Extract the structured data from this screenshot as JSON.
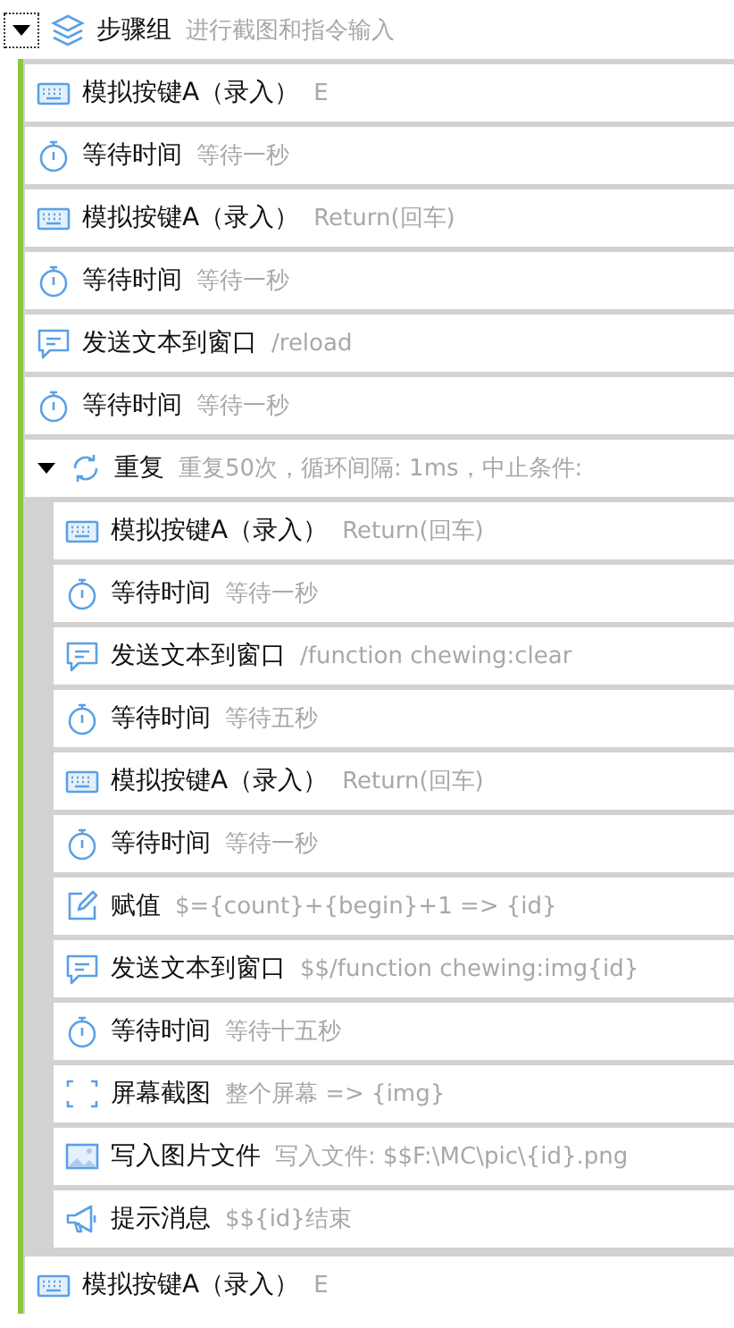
{
  "group": {
    "title": "步骤组",
    "detail": "进行截图和指令输入",
    "expanded": true,
    "steps": [
      {
        "kind": "keyboard",
        "title": "模拟按键A（录入）",
        "detail": "E"
      },
      {
        "kind": "wait",
        "title": "等待时间",
        "detail": "等待一秒"
      },
      {
        "kind": "keyboard",
        "title": "模拟按键A（录入）",
        "detail": "Return(回车)"
      },
      {
        "kind": "wait",
        "title": "等待时间",
        "detail": "等待一秒"
      },
      {
        "kind": "send",
        "title": "发送文本到窗口",
        "detail": "/reload"
      },
      {
        "kind": "wait",
        "title": "等待时间",
        "detail": "等待一秒"
      },
      {
        "kind": "repeat",
        "title": "重复",
        "detail": "重复50次，循环间隔: 1ms，中止条件:",
        "expanded": true,
        "steps": [
          {
            "kind": "keyboard",
            "title": "模拟按键A（录入）",
            "detail": "Return(回车)"
          },
          {
            "kind": "wait",
            "title": "等待时间",
            "detail": "等待一秒"
          },
          {
            "kind": "send",
            "title": "发送文本到窗口",
            "detail": "/function chewing:clear"
          },
          {
            "kind": "wait",
            "title": "等待时间",
            "detail": "等待五秒"
          },
          {
            "kind": "keyboard",
            "title": "模拟按键A（录入）",
            "detail": "Return(回车)"
          },
          {
            "kind": "wait",
            "title": "等待时间",
            "detail": "等待一秒"
          },
          {
            "kind": "assign",
            "title": "赋值",
            "detail": "$={count}+{begin}+1 => {id}"
          },
          {
            "kind": "send",
            "title": "发送文本到窗口",
            "detail": "$$/function chewing:img{id}"
          },
          {
            "kind": "wait",
            "title": "等待时间",
            "detail": "等待十五秒"
          },
          {
            "kind": "screenshot",
            "title": "屏幕截图",
            "detail": "整个屏幕 => {img}"
          },
          {
            "kind": "image",
            "title": "写入图片文件",
            "detail": "写入文件: $$F:\\MC\\pic\\{id}.png"
          },
          {
            "kind": "notify",
            "title": "提示消息",
            "detail": "$${id}结束"
          }
        ]
      },
      {
        "kind": "keyboard",
        "title": "模拟按键A（录入）",
        "detail": "E"
      }
    ]
  }
}
